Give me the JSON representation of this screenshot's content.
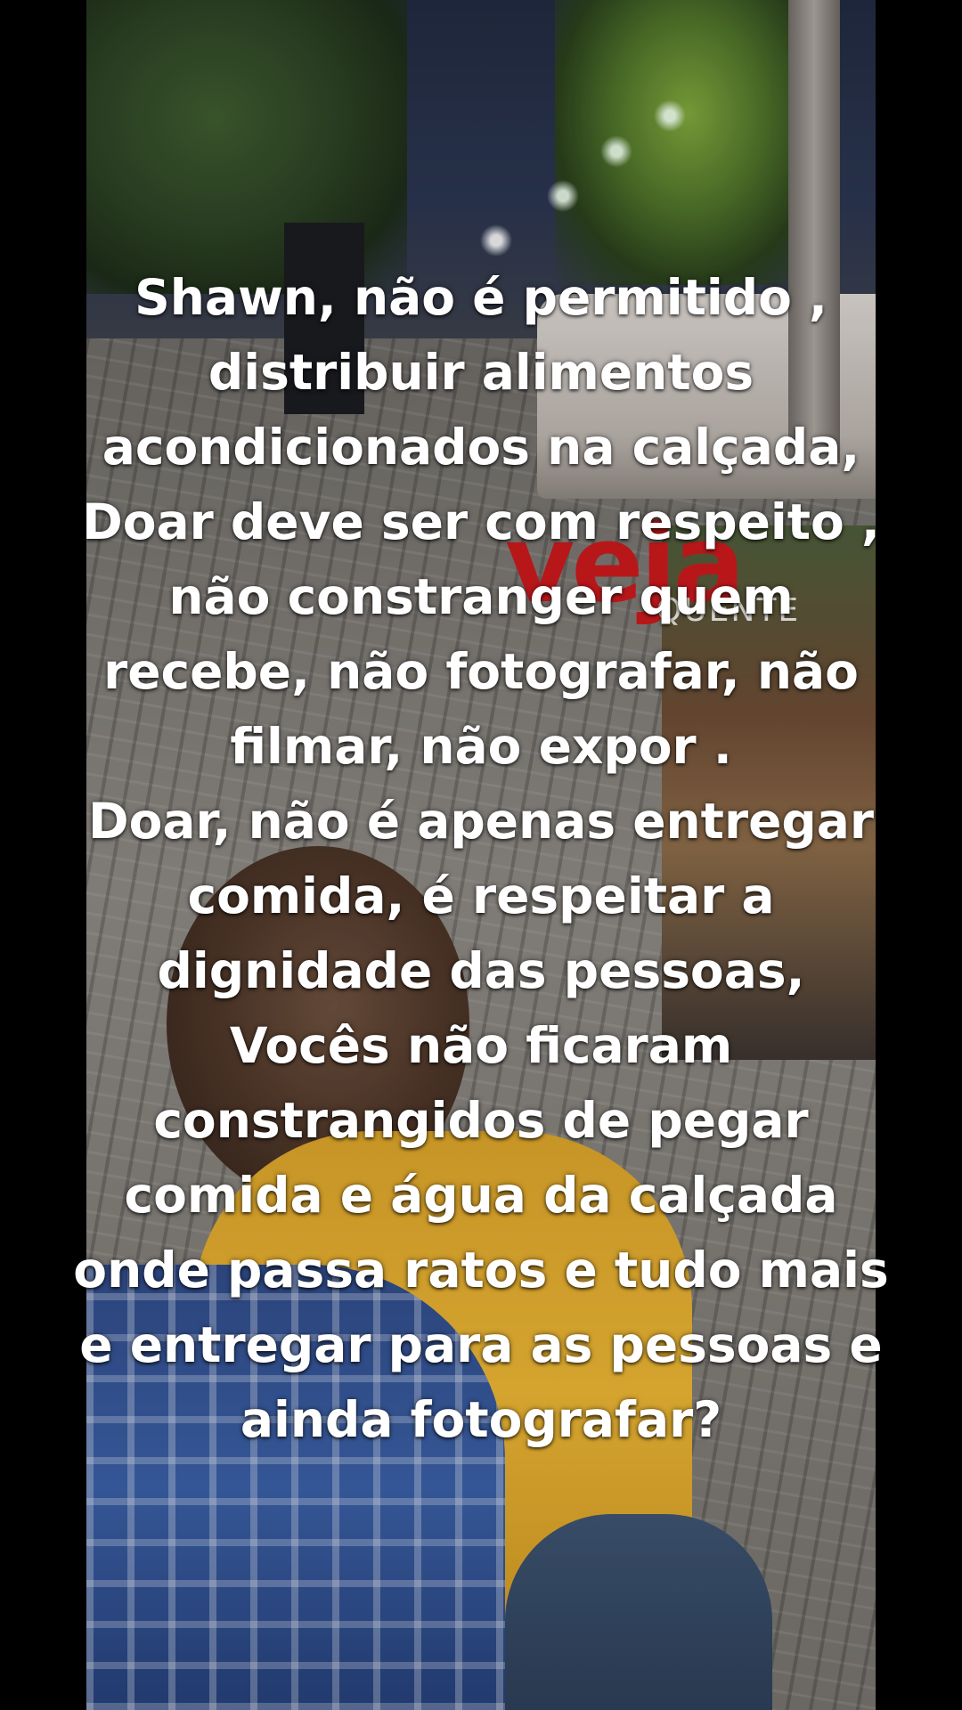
{
  "watermark": {
    "logo_text": "veja",
    "logo_subtext": "QUENTE",
    "logo_color": "#c81a1d"
  },
  "caption": {
    "lines": [
      "Shawn, não é permitido ,",
      "distribuir alimentos",
      "acondicionados na calçada,",
      "Doar deve ser com respeito ,",
      "não constranger quem",
      "recebe, não fotografar, não",
      "filmar, não expor .",
      "Doar, não é apenas entregar",
      "comida, é respeitar a",
      "dignidade das pessoas,",
      "Vocês não ficaram",
      "constrangidos de pegar",
      "comida e água da calçada",
      "onde passa ratos e tudo mais",
      "e entregar para as pessoas e",
      "ainda fotografar?"
    ],
    "text_color": "#ffffff"
  }
}
